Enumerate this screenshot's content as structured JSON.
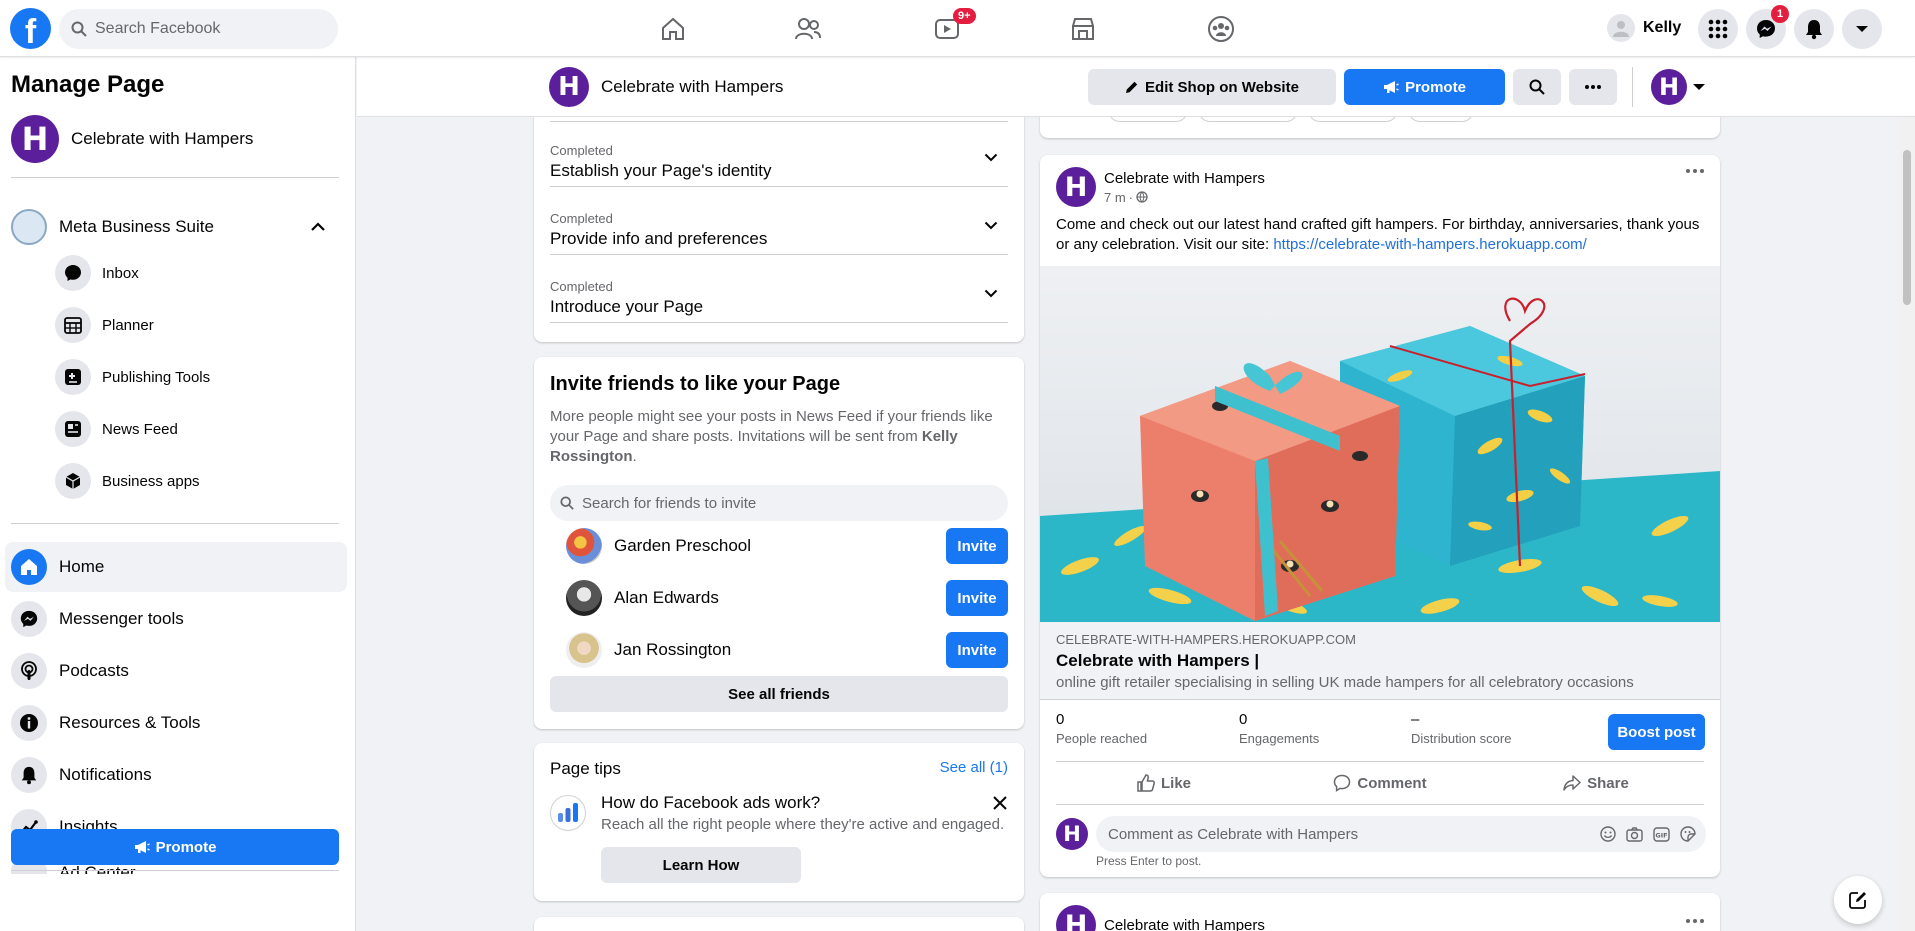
{
  "topbar": {
    "logo": "f",
    "search_placeholder": "Search Facebook",
    "watch_badge": "9+",
    "user_name": "Kelly",
    "messenger_badge": "1"
  },
  "sidebar": {
    "title": "Manage Page",
    "page_name": "Celebrate with Hampers",
    "suite_label": "Meta Business Suite",
    "suite_items": [
      {
        "label": "Inbox",
        "icon": "inbox-icon"
      },
      {
        "label": "Planner",
        "icon": "planner-icon"
      },
      {
        "label": "Publishing Tools",
        "icon": "publishing-tools-icon"
      },
      {
        "label": "News Feed",
        "icon": "news-feed-icon"
      },
      {
        "label": "Business apps",
        "icon": "business-apps-icon"
      }
    ],
    "main_items": [
      {
        "label": "Home",
        "icon": "home-icon",
        "active": true
      },
      {
        "label": "Messenger tools",
        "icon": "messenger-icon"
      },
      {
        "label": "Podcasts",
        "icon": "podcast-icon"
      },
      {
        "label": "Resources & Tools",
        "icon": "info-icon"
      },
      {
        "label": "Notifications",
        "icon": "bell-icon"
      },
      {
        "label": "Insights",
        "icon": "insights-icon"
      }
    ],
    "cut_off_item": "Ad Center",
    "promote_label": "Promote"
  },
  "page_header": {
    "page_name": "Celebrate with Hampers",
    "logo_letter": "H",
    "edit_shop_label": "Edit Shop on Website",
    "promote_label": "Promote"
  },
  "setup": {
    "steps": [
      {
        "status": "Completed",
        "label": "Establish your Page's identity"
      },
      {
        "status": "Completed",
        "label": "Provide info and preferences"
      },
      {
        "status": "Completed",
        "label": "Introduce your Page"
      }
    ]
  },
  "invite": {
    "title": "Invite friends to like your Page",
    "desc_prefix": "More people might see your posts in News Feed if your friends like your Page and share posts. Invitations will be sent from ",
    "desc_name": "Kelly Rossington",
    "desc_suffix": ".",
    "search_placeholder": "Search for friends to invite",
    "friends": [
      {
        "name": "Garden Preschool",
        "button": "Invite"
      },
      {
        "name": "Alan Edwards",
        "button": "Invite"
      },
      {
        "name": "Jan Rossington",
        "button": "Invite"
      }
    ],
    "see_all_label": "See all friends"
  },
  "tips": {
    "title": "Page tips",
    "see_all": "See all (1)",
    "question": "How do Facebook ads work?",
    "description": "Reach all the right people where they're active and engaged.",
    "button": "Learn How"
  },
  "post": {
    "author": "Celebrate with Hampers",
    "time": "7 m",
    "text": "Come and check out our latest hand crafted gift hampers. For birthday, anniversaries, thank yous or any celebration. Visit our site: ",
    "link": "https://celebrate-with-hampers.herokuapp.com/",
    "link_domain": "CELEBRATE-WITH-HAMPERS.HEROKUAPP.COM",
    "link_title": "Celebrate with Hampers |",
    "link_desc": "online gift retailer specialising in selling UK made hampers for all celebratory occasions",
    "stats": [
      {
        "value": "0",
        "label": "People reached"
      },
      {
        "value": "0",
        "label": "Engagements"
      },
      {
        "value": "–",
        "label": "Distribution score"
      }
    ],
    "boost_label": "Boost post",
    "actions": {
      "like": "Like",
      "comment": "Comment",
      "share": "Share"
    },
    "comment_placeholder": "Comment as Celebrate with Hampers",
    "press_enter": "Press Enter to post."
  },
  "next_post": {
    "author": "Celebrate with Hampers"
  },
  "colors": {
    "accent": "#1877f2",
    "brand_purple": "#5b1f9c",
    "background": "#f0f2f5"
  }
}
